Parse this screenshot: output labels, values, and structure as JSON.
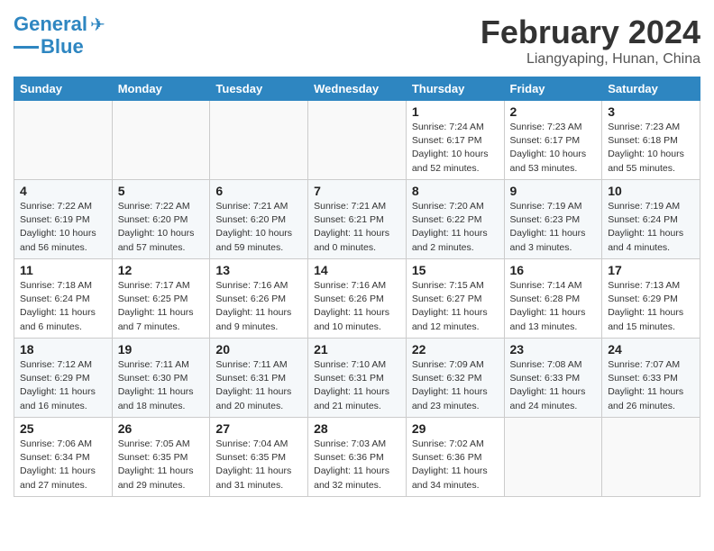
{
  "header": {
    "logo_line1": "General",
    "logo_line2": "Blue",
    "month": "February 2024",
    "location": "Liangyaping, Hunan, China"
  },
  "days_of_week": [
    "Sunday",
    "Monday",
    "Tuesday",
    "Wednesday",
    "Thursday",
    "Friday",
    "Saturday"
  ],
  "weeks": [
    [
      {
        "day": "",
        "info": ""
      },
      {
        "day": "",
        "info": ""
      },
      {
        "day": "",
        "info": ""
      },
      {
        "day": "",
        "info": ""
      },
      {
        "day": "1",
        "info": "Sunrise: 7:24 AM\nSunset: 6:17 PM\nDaylight: 10 hours\nand 52 minutes."
      },
      {
        "day": "2",
        "info": "Sunrise: 7:23 AM\nSunset: 6:17 PM\nDaylight: 10 hours\nand 53 minutes."
      },
      {
        "day": "3",
        "info": "Sunrise: 7:23 AM\nSunset: 6:18 PM\nDaylight: 10 hours\nand 55 minutes."
      }
    ],
    [
      {
        "day": "4",
        "info": "Sunrise: 7:22 AM\nSunset: 6:19 PM\nDaylight: 10 hours\nand 56 minutes."
      },
      {
        "day": "5",
        "info": "Sunrise: 7:22 AM\nSunset: 6:20 PM\nDaylight: 10 hours\nand 57 minutes."
      },
      {
        "day": "6",
        "info": "Sunrise: 7:21 AM\nSunset: 6:20 PM\nDaylight: 10 hours\nand 59 minutes."
      },
      {
        "day": "7",
        "info": "Sunrise: 7:21 AM\nSunset: 6:21 PM\nDaylight: 11 hours\nand 0 minutes."
      },
      {
        "day": "8",
        "info": "Sunrise: 7:20 AM\nSunset: 6:22 PM\nDaylight: 11 hours\nand 2 minutes."
      },
      {
        "day": "9",
        "info": "Sunrise: 7:19 AM\nSunset: 6:23 PM\nDaylight: 11 hours\nand 3 minutes."
      },
      {
        "day": "10",
        "info": "Sunrise: 7:19 AM\nSunset: 6:24 PM\nDaylight: 11 hours\nand 4 minutes."
      }
    ],
    [
      {
        "day": "11",
        "info": "Sunrise: 7:18 AM\nSunset: 6:24 PM\nDaylight: 11 hours\nand 6 minutes."
      },
      {
        "day": "12",
        "info": "Sunrise: 7:17 AM\nSunset: 6:25 PM\nDaylight: 11 hours\nand 7 minutes."
      },
      {
        "day": "13",
        "info": "Sunrise: 7:16 AM\nSunset: 6:26 PM\nDaylight: 11 hours\nand 9 minutes."
      },
      {
        "day": "14",
        "info": "Sunrise: 7:16 AM\nSunset: 6:26 PM\nDaylight: 11 hours\nand 10 minutes."
      },
      {
        "day": "15",
        "info": "Sunrise: 7:15 AM\nSunset: 6:27 PM\nDaylight: 11 hours\nand 12 minutes."
      },
      {
        "day": "16",
        "info": "Sunrise: 7:14 AM\nSunset: 6:28 PM\nDaylight: 11 hours\nand 13 minutes."
      },
      {
        "day": "17",
        "info": "Sunrise: 7:13 AM\nSunset: 6:29 PM\nDaylight: 11 hours\nand 15 minutes."
      }
    ],
    [
      {
        "day": "18",
        "info": "Sunrise: 7:12 AM\nSunset: 6:29 PM\nDaylight: 11 hours\nand 16 minutes."
      },
      {
        "day": "19",
        "info": "Sunrise: 7:11 AM\nSunset: 6:30 PM\nDaylight: 11 hours\nand 18 minutes."
      },
      {
        "day": "20",
        "info": "Sunrise: 7:11 AM\nSunset: 6:31 PM\nDaylight: 11 hours\nand 20 minutes."
      },
      {
        "day": "21",
        "info": "Sunrise: 7:10 AM\nSunset: 6:31 PM\nDaylight: 11 hours\nand 21 minutes."
      },
      {
        "day": "22",
        "info": "Sunrise: 7:09 AM\nSunset: 6:32 PM\nDaylight: 11 hours\nand 23 minutes."
      },
      {
        "day": "23",
        "info": "Sunrise: 7:08 AM\nSunset: 6:33 PM\nDaylight: 11 hours\nand 24 minutes."
      },
      {
        "day": "24",
        "info": "Sunrise: 7:07 AM\nSunset: 6:33 PM\nDaylight: 11 hours\nand 26 minutes."
      }
    ],
    [
      {
        "day": "25",
        "info": "Sunrise: 7:06 AM\nSunset: 6:34 PM\nDaylight: 11 hours\nand 27 minutes."
      },
      {
        "day": "26",
        "info": "Sunrise: 7:05 AM\nSunset: 6:35 PM\nDaylight: 11 hours\nand 29 minutes."
      },
      {
        "day": "27",
        "info": "Sunrise: 7:04 AM\nSunset: 6:35 PM\nDaylight: 11 hours\nand 31 minutes."
      },
      {
        "day": "28",
        "info": "Sunrise: 7:03 AM\nSunset: 6:36 PM\nDaylight: 11 hours\nand 32 minutes."
      },
      {
        "day": "29",
        "info": "Sunrise: 7:02 AM\nSunset: 6:36 PM\nDaylight: 11 hours\nand 34 minutes."
      },
      {
        "day": "",
        "info": ""
      },
      {
        "day": "",
        "info": ""
      }
    ]
  ]
}
